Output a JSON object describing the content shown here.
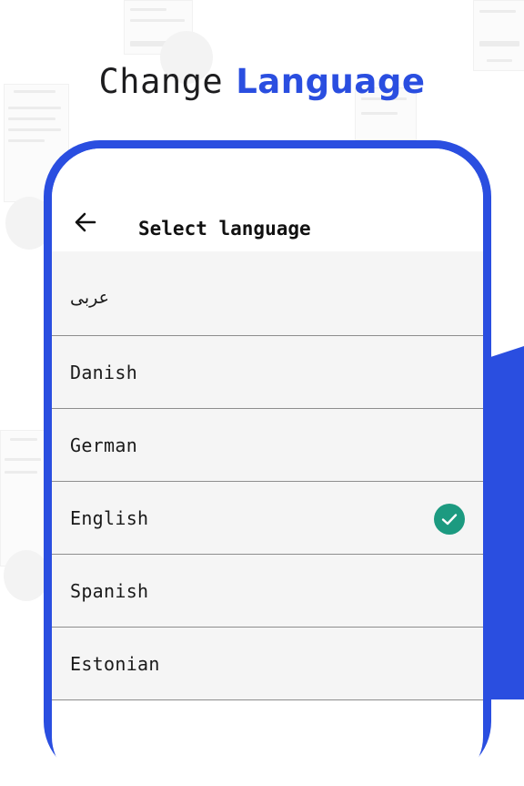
{
  "headline": {
    "part1": "Change",
    "part2": "Language"
  },
  "screen": {
    "title": "Select language",
    "back_icon": "arrow-left-icon",
    "languages": [
      {
        "label": "عربى",
        "selected": false
      },
      {
        "label": "Danish",
        "selected": false
      },
      {
        "label": "German",
        "selected": false
      },
      {
        "label": "English",
        "selected": true
      },
      {
        "label": "Spanish",
        "selected": false
      },
      {
        "label": "Estonian",
        "selected": false
      }
    ],
    "selected_icon": "check-circle-icon"
  },
  "colors": {
    "accent": "#2a4ee0",
    "check": "#1c9a80",
    "list_bg": "#f5f5f5"
  }
}
